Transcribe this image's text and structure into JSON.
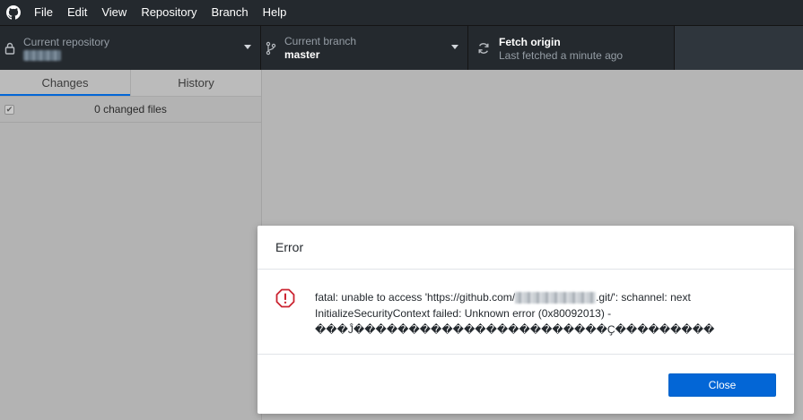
{
  "menubar": {
    "logo_icon": "github-octocat-icon",
    "items": [
      "File",
      "Edit",
      "View",
      "Repository",
      "Branch",
      "Help"
    ]
  },
  "toolbar": {
    "repository": {
      "label": "Current repository",
      "icon": "lock-icon"
    },
    "branch": {
      "label": "Current branch",
      "value": "master",
      "icon": "git-branch-icon"
    },
    "fetch": {
      "title": "Fetch origin",
      "subtitle": "Last fetched a minute ago",
      "icon": "sync-icon"
    }
  },
  "sidebar": {
    "tabs": [
      {
        "label": "Changes",
        "selected": true
      },
      {
        "label": "History",
        "selected": false
      }
    ],
    "changes_count": "0 changed files"
  },
  "dialog": {
    "title": "Error",
    "icon": "alert-octagon-icon",
    "message_part1": "fatal: unable to access 'https://github.com/",
    "message_part2": ".git/': schannel: next InitializeSecurityContext failed: Unknown error (0x80092013) - ���Ĵ�����������������������Ҫ���������",
    "close_label": "Close"
  },
  "colors": {
    "toolbar_bg": "#24292e",
    "accent": "#0366d6",
    "error_red": "#cb2431"
  }
}
